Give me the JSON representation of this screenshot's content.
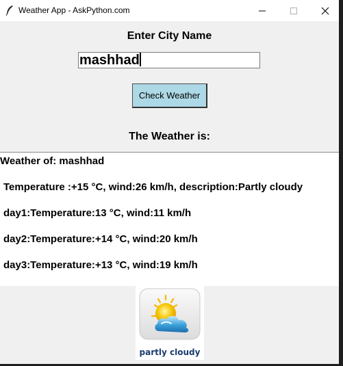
{
  "window": {
    "title": "Weather App - AskPython.com",
    "app_icon": "feather-icon",
    "controls": [
      "minimize-icon",
      "maximize-icon",
      "close-icon"
    ]
  },
  "form": {
    "heading": "Enter City Name",
    "city_value": "mashhad",
    "button_label": "Check Weather",
    "result_heading": "The Weather is:"
  },
  "result": {
    "lines": [
      "Weather of: mashhad",
      "Temperature :+15 °C, wind:26 km/h, description:Partly cloudy",
      "day1:Temperature:13 °C, wind:11 km/h",
      "day2:Temperature:+14 °C, wind:20 km/h",
      "day3:Temperature:+13 °C, wind:19 km/h"
    ]
  },
  "weather_image": {
    "icon": "partly-cloudy-icon",
    "caption": "partly cloudy",
    "colors": {
      "sun": "#f5c400",
      "cloud": "#3aa0d8",
      "caption": "#1a3c6e"
    }
  },
  "colors": {
    "button": "#add8e6",
    "window": "#f0f0f0",
    "panel": "#ffffff"
  }
}
